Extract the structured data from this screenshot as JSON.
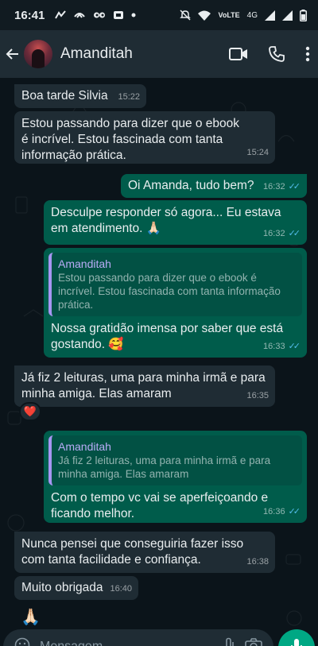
{
  "status_bar": {
    "time": "16:41",
    "network": "4G",
    "lte": "VoLTE"
  },
  "header": {
    "contact_name": "Amanditah"
  },
  "messages": [
    {
      "text": "Boa tarde Silvia",
      "time": "15:22"
    },
    {
      "text": "Estou passando para dizer que o ebook\né incrível. Estou fascinada com tanta\ninformação prática.",
      "time": "15:24"
    },
    {
      "text": "Oi Amanda, tudo bem?",
      "time": "16:32"
    },
    {
      "text": "Desculpe responder só agora... Eu estava\nem atendimento. 🙏🏻",
      "time": "16:32"
    },
    {
      "quote_name": "Amanditah",
      "quote_text": "Estou passando para dizer que o ebook é\nincrível. Estou fascinada com tanta informação\nprática.",
      "text": "Nossa gratidão imensa por saber que está\ngostando. 🥰",
      "time": "16:33"
    },
    {
      "text": "Já fiz 2 leituras, uma para minha irmã e para\nminha amiga. Elas amaram",
      "time": "16:35",
      "reaction": "❤️"
    },
    {
      "quote_name": "Amanditah",
      "quote_text": "Já fiz 2 leituras, uma para minha irmã e para\nminha amiga. Elas amaram",
      "text": "Com o tempo vc vai se aperfeiçoando e\nficando melhor.",
      "time": "16:36"
    },
    {
      "text": "Nunca pensei que conseguiria fazer isso\ncom tanta facilidade e confiança.",
      "time": "16:38"
    },
    {
      "text": "Muito obrigada",
      "time": "16:40"
    },
    {
      "sticker": "🙏🏻"
    }
  ],
  "composer": {
    "placeholder": "Mensagem"
  },
  "colors": {
    "background": "#0b141a",
    "header": "#1f2c34",
    "incoming_bubble": "#1f2c34",
    "outgoing_bubble": "#005c4b",
    "read_ticks": "#53bdeb",
    "quote_accent": "#a796f2",
    "send_button": "#00a884"
  },
  "icons": [
    "arrow-back-icon",
    "video-call-icon",
    "phone-icon",
    "more-vert-icon",
    "read-receipt-icon",
    "attach-icon",
    "camera-icon",
    "mic-icon"
  ]
}
